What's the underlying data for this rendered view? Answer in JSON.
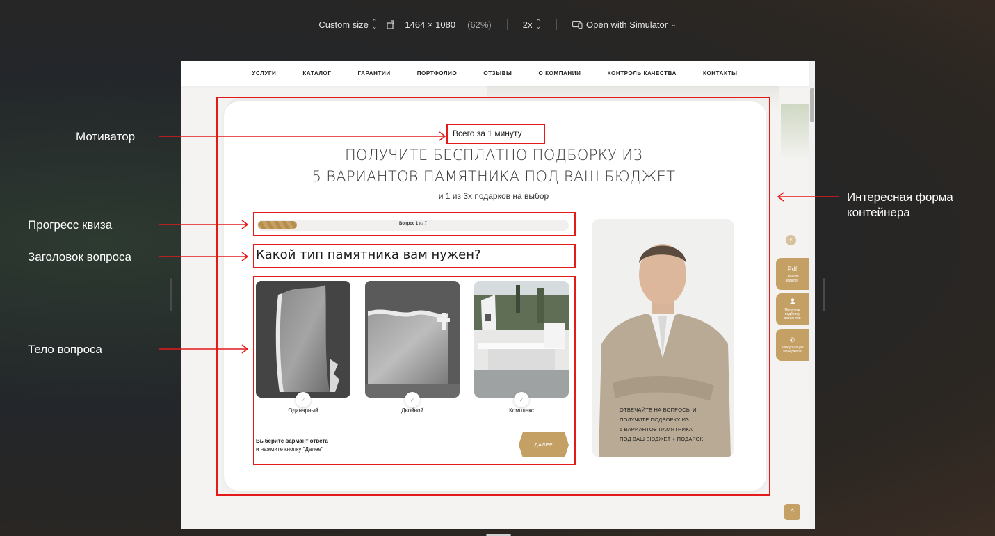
{
  "toolbar": {
    "size_mode": "Custom size",
    "dims": "1464 × 1080",
    "zoom": "(62%)",
    "scale": "2x",
    "open_with": "Open with Simulator"
  },
  "nav": [
    "УСЛУГИ",
    "КАТАЛОГ",
    "ГАРАНТИИ",
    "ПОРТФОЛИО",
    "ОТЗЫВЫ",
    "О КОМПАНИИ",
    "КОНТРОЛЬ КАЧЕСТВА",
    "КОНТАКТЫ"
  ],
  "quiz": {
    "motivator": "Всего за 1 минуту",
    "title_line1": "ПОЛУЧИТЕ БЕСПЛАТНО ПОДБОРКУ ИЗ",
    "title_line2": "5 ВАРИАНТОВ ПАМЯТНИКА ПОД ВАШ БЮДЖЕТ",
    "subtitle": "и 1 из 3х подарков на выбор",
    "progress_bold": "Вопрос 1",
    "progress_rest": " из 7",
    "progress_fraction": 0.125,
    "question": "Какой тип памятника вам нужен?",
    "options": [
      "Одинарный",
      "Двойной",
      "Комплекс"
    ],
    "hint_bold": "Выберите вармант ответа",
    "hint_rest": "и нажмите кнопку \"Далее\"",
    "next_label": "ДАЛЕЕ"
  },
  "manager": {
    "quote_mark": "“",
    "lines": [
      "ОТВЕЧАЙТЕ НА ВОПРОСЫ И",
      "ПОЛУЧИТЕ ПОДБОРКУ ИЗ",
      "5 ВАРИАНТОВ ПАМЯТНИКА",
      "ПОД ВАШ БЮДЖЕТ + ПОДАРОК"
    ]
  },
  "side": {
    "close": "×",
    "pdf_icon": "Pdf",
    "pdf_label": "Скачать каталог",
    "pick_label": "Получить подборку вариантов",
    "call_label": "Консультация менеджера",
    "up": "^"
  },
  "annotations": {
    "motivator": "Мотиватор",
    "progress": "Прогресс квиза",
    "question_title": "Заголовок вопроса",
    "question_body": "Тело вопроса",
    "container_line1": "Интересная форма",
    "container_line2": "контейнера"
  },
  "colors": {
    "accent": "#c5a064",
    "annotation": "#e31a1a"
  }
}
